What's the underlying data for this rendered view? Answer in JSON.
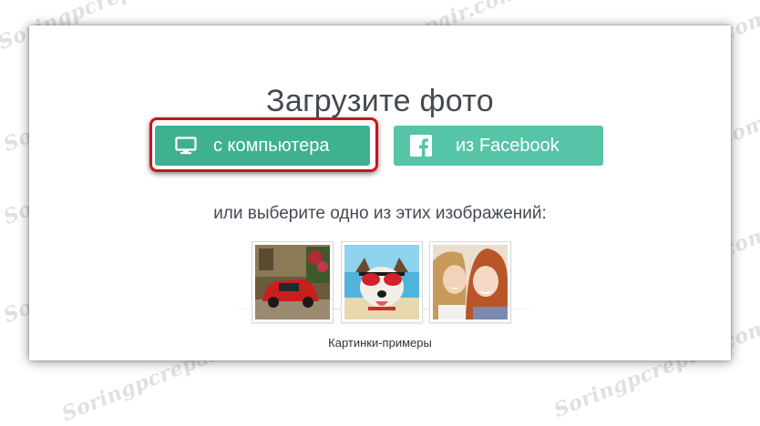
{
  "title": "Загрузите фото",
  "buttons": {
    "computer_label": "с компьютера",
    "facebook_label": "из Facebook"
  },
  "subtitle": "или выберите одно из этих изображений:",
  "examples_caption": "Картинки-примеры",
  "watermark": "Soringpcrepair.com",
  "colors": {
    "button_primary": "#3fb090",
    "button_secondary": "#56c4a6",
    "highlight_frame": "#d0111a",
    "text": "#444a50"
  },
  "icons": {
    "computer_button": "monitor-icon",
    "facebook_button": "facebook-icon"
  },
  "sample_images": [
    {
      "name": "sample-red-car-thumbnail"
    },
    {
      "name": "sample-dog-sunglasses-thumbnail"
    },
    {
      "name": "sample-two-women-thumbnail"
    }
  ]
}
